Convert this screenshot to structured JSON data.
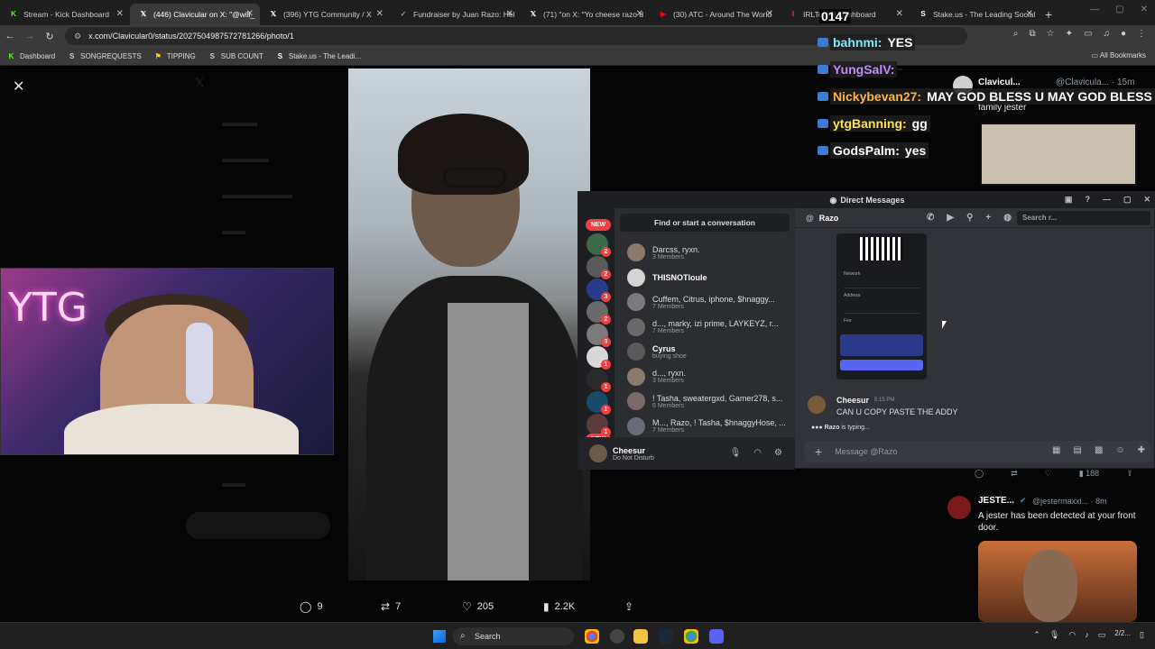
{
  "browser": {
    "tabs": [
      {
        "title": "Stream - Kick Dashboard",
        "icon": "kick-icon",
        "color": "#53fc18",
        "glyph": "K"
      },
      {
        "title": "(446) Clavicular on X: \"@will_",
        "icon": "x-icon",
        "color": "#ffffff",
        "glyph": "𝕏",
        "active": true
      },
      {
        "title": "(396) YTG Community / X",
        "icon": "x-icon",
        "color": "#ffffff",
        "glyph": "𝕏"
      },
      {
        "title": "Fundraiser by Juan Razo: Hel",
        "icon": "gofundme-icon",
        "color": "#65bd60",
        "glyph": "✓"
      },
      {
        "title": "(71) \"on X: \"Yo cheese razo d",
        "icon": "x-icon",
        "color": "#ffffff",
        "glyph": "𝕏"
      },
      {
        "title": "(30) ATC - Around The World",
        "icon": "youtube-icon",
        "color": "#ff0000",
        "glyph": "▶"
      },
      {
        "title": "IRLToolkit Dashboard",
        "icon": "irltoolkit-icon",
        "color": "#e33",
        "glyph": "I"
      },
      {
        "title": "Stake.us - The Leading Social",
        "icon": "stake-icon",
        "color": "#ffffff",
        "glyph": "S"
      }
    ],
    "url": "x.com/Clavicular0/status/2027504987572781266/photo/1",
    "bookmarks": [
      {
        "label": "Dashboard",
        "icon": "kick-icon",
        "color": "#53fc18",
        "glyph": "K"
      },
      {
        "label": "SONGREQUESTS",
        "icon": "streamelements-icon",
        "color": "#cfcfcf",
        "glyph": "S"
      },
      {
        "label": "TIPPING",
        "icon": "tipping-icon",
        "color": "#f7d400",
        "glyph": "⚑"
      },
      {
        "label": "SUB COUNT",
        "icon": "subcount-icon",
        "color": "#cfcfcf",
        "glyph": "S"
      },
      {
        "label": "Stake.us - The Leadi...",
        "icon": "stake-icon",
        "color": "#ffffff",
        "glyph": "S"
      }
    ],
    "all_bookmarks": "All Bookmarks"
  },
  "viewer": {
    "close": "✕",
    "stats": {
      "replies": "9",
      "reposts": "7",
      "likes": "205",
      "views": "2.2K"
    }
  },
  "overlay": {
    "counter": "0147",
    "chat": [
      {
        "user": "bahnmi:",
        "msg": "YES",
        "color": "#7ee7ff"
      },
      {
        "user": "YungSalV:",
        "msg": "",
        "color": "#c08bff"
      },
      {
        "user": "Nickybevan27:",
        "msg": "MAY GOD BLESS U MAY GOD BLESS U",
        "color": "#ffb347"
      },
      {
        "user": "ytgBanning:",
        "msg": "gg",
        "color": "#ffe14a"
      },
      {
        "user": "GodsPalm:",
        "msg": "yes",
        "color": "#ffffff"
      }
    ]
  },
  "tweet_top": {
    "name": "Clavicul...",
    "handle": "@Clavicula... · 15m",
    "text": "family jester"
  },
  "discord": {
    "title": "Direct Messages",
    "find": "Find or start a conversation",
    "dms": [
      {
        "name": "Darcss, ryxn.",
        "sub": "3 Members",
        "color": "#8a7a6a"
      },
      {
        "name": "THISNOTloule",
        "sub": "",
        "color": "#d4d4d4",
        "bright": true
      },
      {
        "name": "Cuffem, Citrus, iphone, $hnaggy...",
        "sub": "7 Members",
        "color": "#7a7a7a"
      },
      {
        "name": "d..., marky, izi prime, LAYKEYZ, r...",
        "sub": "7 Members",
        "color": "#6a6a6a"
      },
      {
        "name": "Cyrus",
        "sub": "buying shoe",
        "color": "#5a5a5a",
        "bright": true
      },
      {
        "name": "d..., ryxn.",
        "sub": "3 Members",
        "color": "#8a7a6a"
      },
      {
        "name": "! Tasha, sweatergxd, Gamer278, s...",
        "sub": "6 Members",
        "color": "#7a6a6a"
      },
      {
        "name": "M..., Razo, ! Tasha, $hnaggyHose, ...",
        "sub": "7 Members",
        "color": "#6a6a7a"
      }
    ],
    "servers": [
      "2",
      "2",
      "3",
      "2",
      "3",
      "1",
      "1",
      "1",
      "1"
    ],
    "new_label": "NEW",
    "user": {
      "name": "Cheesur",
      "status": "Do Not Disturb"
    },
    "channel": "Razo",
    "search": "Search r...",
    "qr": {
      "network": "Network",
      "address": "Address",
      "fee": "Fee"
    },
    "message": {
      "author": "Cheesur",
      "time": "5:15 PM",
      "content": "CAN U COPY PASTE THE ADDY"
    },
    "typing_user": "Razo",
    "typing_text": "is typing...",
    "input_placeholder": "Message @Razo"
  },
  "tweet_bottom": {
    "name": "JESTE...",
    "handle": "@jestermaxxi... · 8m",
    "text": "A jester has been detected at your front door.",
    "views": "188"
  },
  "taskbar": {
    "search": "Search",
    "date": "2/2..."
  }
}
